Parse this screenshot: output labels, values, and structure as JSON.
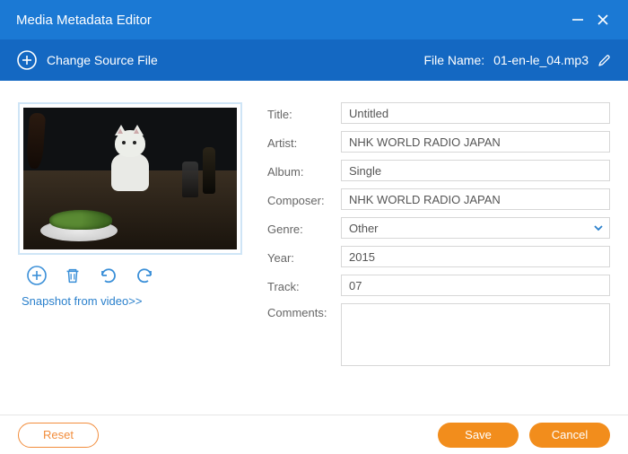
{
  "titlebar": {
    "title": "Media Metadata Editor"
  },
  "subbar": {
    "change_source_label": "Change Source File",
    "filename_label": "File Name:",
    "filename_value": "01-en-le_04.mp3"
  },
  "snapshot_link": "Snapshot from video>>",
  "form": {
    "title_label": "Title:",
    "title_value": "Untitled",
    "artist_label": "Artist:",
    "artist_value": "NHK WORLD RADIO JAPAN",
    "album_label": "Album:",
    "album_value": "Single",
    "composer_label": "Composer:",
    "composer_value": "NHK WORLD RADIO JAPAN",
    "genre_label": "Genre:",
    "genre_value": "Other",
    "year_label": "Year:",
    "year_value": "2015",
    "track_label": "Track:",
    "track_value": "07",
    "comments_label": "Comments:",
    "comments_value": ""
  },
  "footer": {
    "reset_label": "Reset",
    "save_label": "Save",
    "cancel_label": "Cancel"
  }
}
